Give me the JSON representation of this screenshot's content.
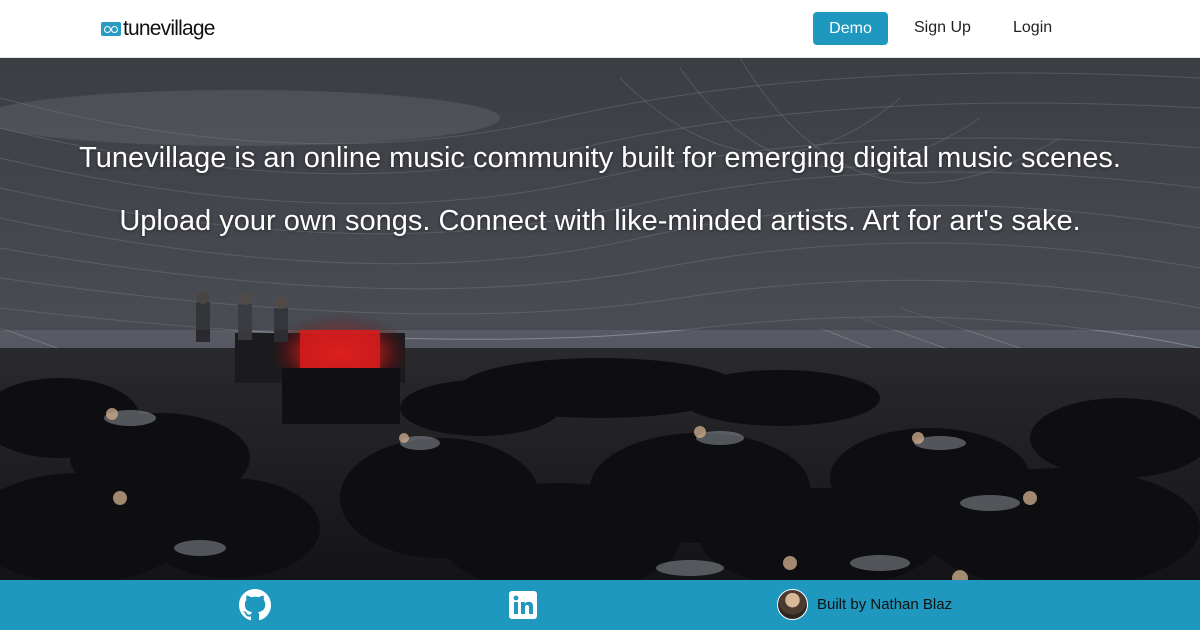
{
  "navbar": {
    "logo_text": "tunevillage",
    "demo_label": "Demo",
    "signup_label": "Sign Up",
    "login_label": "Login"
  },
  "hero": {
    "line1": "Tunevillage is an online music community built for emerging digital music scenes.",
    "line2": "Upload your own songs. Connect with like-minded artists. Art for art's sake."
  },
  "footer": {
    "github_icon": "github-icon",
    "linkedin_icon": "linkedin-icon",
    "built_by": "Built by Nathan Blaz"
  },
  "colors": {
    "accent": "#1f98bf",
    "stage_red": "#e02020"
  }
}
